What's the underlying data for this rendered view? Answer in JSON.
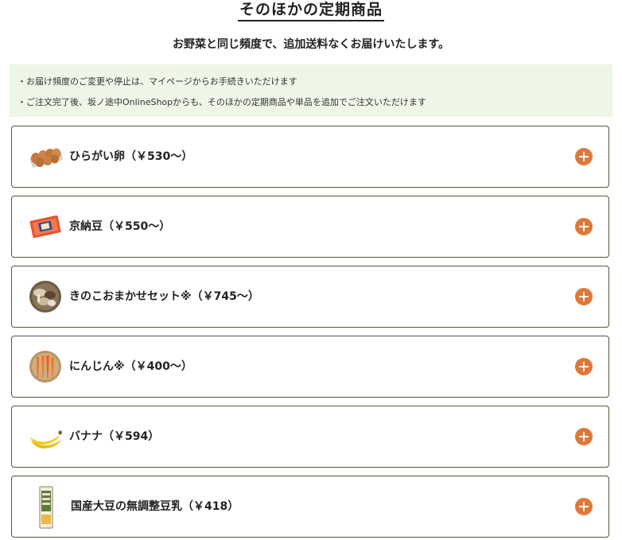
{
  "section": {
    "title": "そのほかの定期商品",
    "subtitle": "お野菜と同じ頻度で、追加送料なくお届けいたします。"
  },
  "notes": [
    "・お届け頻度のご変更や停止は、マイページからお手続きいただけます",
    "・ご注文完了後、坂ノ途中OnlineShopからも、そのほかの定期商品や単品を追加でご注文いただけます"
  ],
  "products": [
    {
      "label": "ひらがい卵（￥530～）",
      "icon": "eggs-icon"
    },
    {
      "label": "京納豆（￥550～）",
      "icon": "natto-icon"
    },
    {
      "label": "きのこおまかせセット※（￥745～）",
      "icon": "mushroom-icon"
    },
    {
      "label": "にんじん※（￥400～）",
      "icon": "carrot-icon"
    },
    {
      "label": "バナナ（￥594）",
      "icon": "banana-icon"
    },
    {
      "label": "国産大豆の無調整豆乳（￥418）",
      "icon": "soymilk-icon"
    }
  ],
  "colors": {
    "accent": "#e0773a",
    "notes_bg": "#eef6e8",
    "border": "#4d5a3a"
  }
}
